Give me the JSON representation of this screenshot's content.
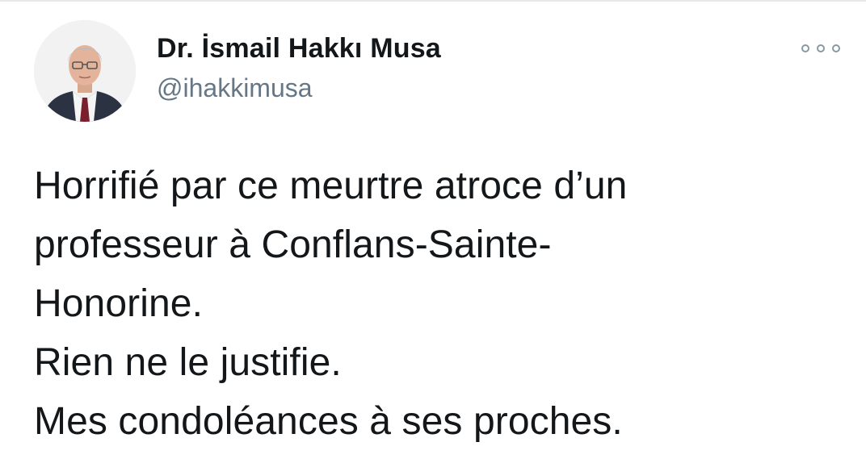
{
  "author": {
    "display_name": "Dr. İsmail Hakkı Musa",
    "handle": "@ihakkimusa"
  },
  "tweet": {
    "lines": [
      "Horrifié par ce meurtre atroce d’un",
      "professeur à Conflans-Sainte-",
      "Honorine.",
      "Rien ne le justifie.",
      "Mes condoléances à ses proches."
    ]
  },
  "icons": {
    "avatar": "profile-photo",
    "more": "more-options-icon"
  },
  "colors": {
    "text": "#14171a",
    "secondary": "#657786",
    "icon": "#8899a6"
  }
}
